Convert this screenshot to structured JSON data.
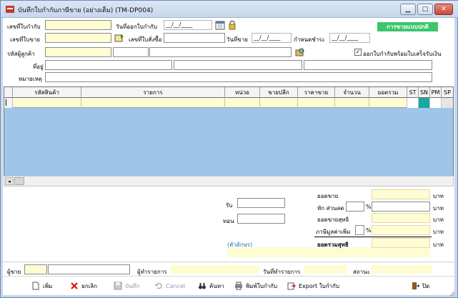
{
  "window": {
    "title": "บันทึกใบกำกับภาษีขาย (อย่างเต็ม) (TM-DP004)"
  },
  "header": {
    "invoice_no_label": "เลขที่ใบกำกับ",
    "invoice_date_label": "วันที่ออกใบกำกับ",
    "invoice_date_value": "__/__/____",
    "badge": "การขายแบบปกติ",
    "sale_no_label": "เลขที่ใบขาย",
    "order_no_label": "เลขที่ใบสั่งซื้อ",
    "sale_date_label": "วันที่ขาย",
    "sale_date_value": "__/__/____",
    "due_label": "กำหนดชำระ",
    "due_value": "__/__/____",
    "customer_label": "รหัสผู้ลูกค้า",
    "receipt_check_label": "ออกใบกำกับพร้อมใบเสร็จรับเงิน",
    "address_label": "ที่อยู่",
    "note_label": "หมายเหตุ"
  },
  "grid": {
    "columns": [
      "รหัสสินค้า",
      "รายการ",
      "หน่วย",
      "ขายปลีก",
      "ราคาขาย",
      "จำนวน",
      "ยอดรวม",
      "ST",
      "SN",
      "PM",
      "SP"
    ]
  },
  "summary": {
    "receive_label": "รับ",
    "change_label": "ทอน",
    "in_words_label": "(ตัวอักษร)",
    "sales_label": "ยอดขาย",
    "discount_label": "หัก ส่วนลด",
    "net_sales_label": "ยอดขายสุทธิ",
    "vat_label": "ภาษีมูลค่าเพิ่ม",
    "net_total_label": "ยอดรวมสุทธิ",
    "baht": "บาท",
    "percent": "%"
  },
  "footer": {
    "seller_label": "ผู้ขาย",
    "recorder_label": "ผู้ทำรายการ",
    "record_date_label": "วันที่ทำรายการ",
    "status_label": "สถานะ"
  },
  "toolbar": {
    "add": "เพิ่ม",
    "cancel_doc": "ยกเลิก",
    "save": "บันทึก",
    "cancel": "Cancel",
    "search": "ค้นหา",
    "print": "พิมพ์ใบกำกับ",
    "export": "Export ใบกำกับ",
    "close": "ปิด"
  },
  "colors": {
    "badge": "#3cc56d",
    "field": "#fffbd3",
    "grid": "#9fc6ea",
    "sn_cell": "#1aa89e"
  }
}
